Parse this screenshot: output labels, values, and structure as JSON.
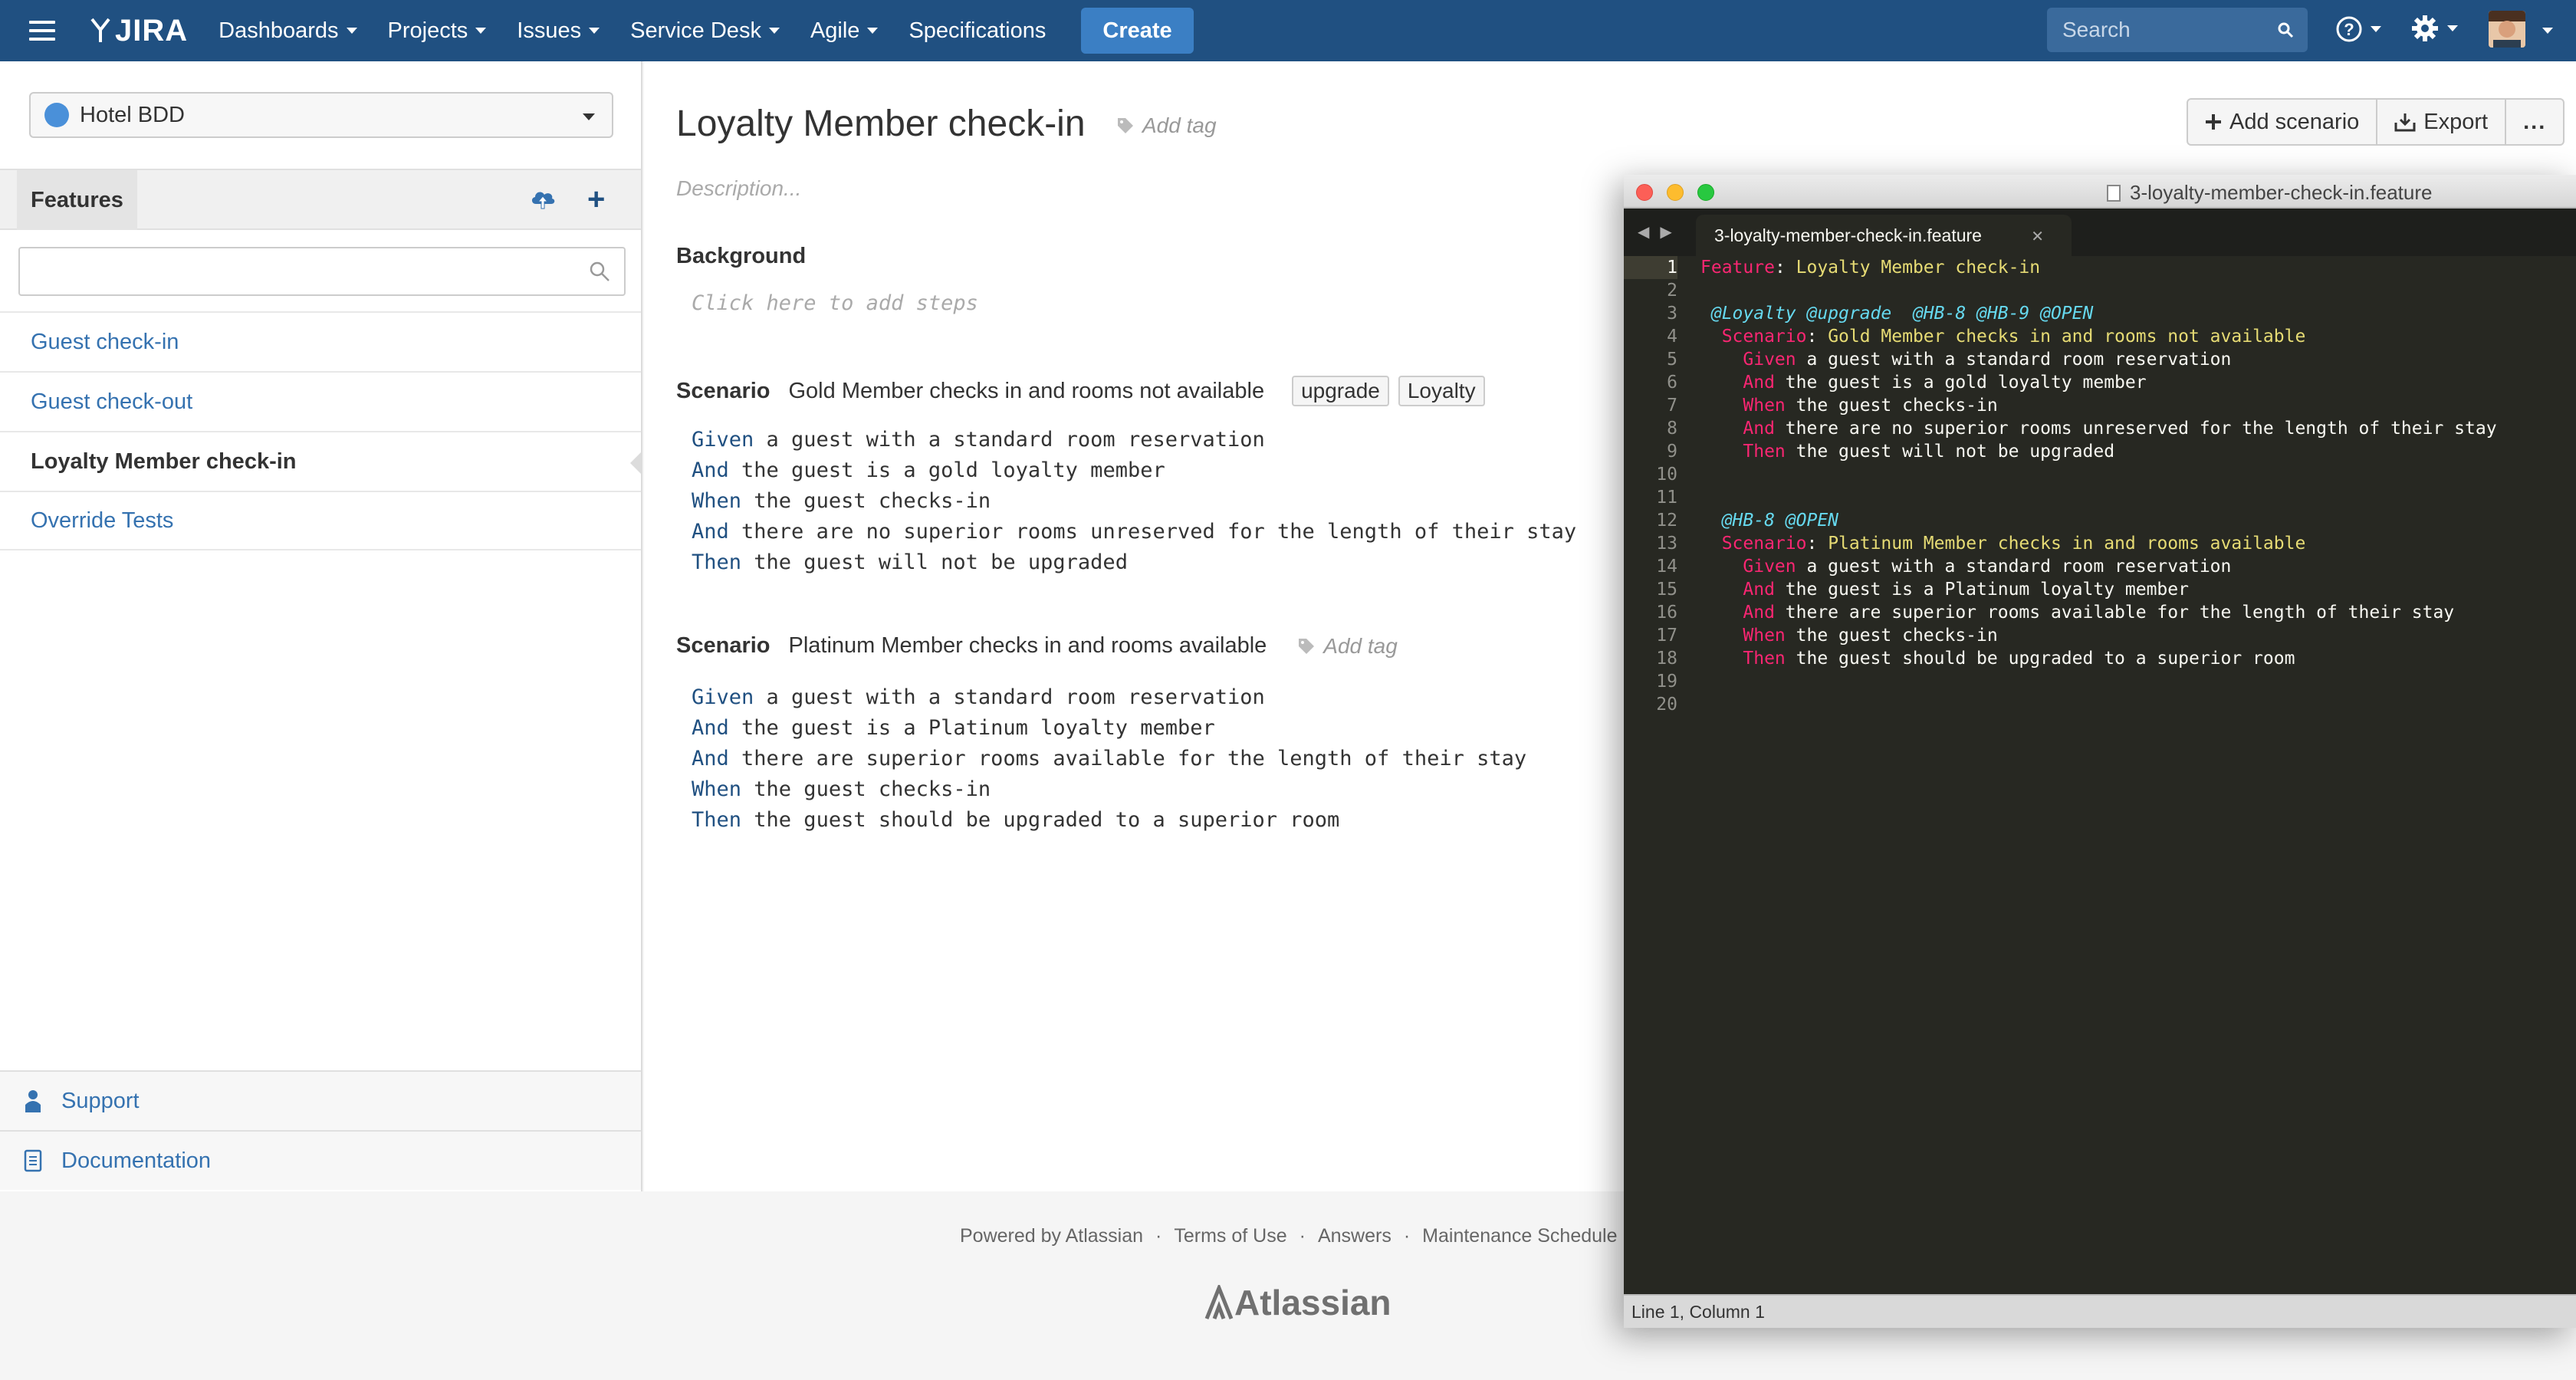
{
  "nav": {
    "logo": "JIRA",
    "items": [
      "Dashboards",
      "Projects",
      "Issues",
      "Service Desk",
      "Agile",
      "Specifications"
    ],
    "create": "Create",
    "search_placeholder": "Search"
  },
  "sidebar": {
    "project": "Hotel BDD",
    "features_tab": "Features",
    "features": [
      "Guest check-in",
      "Guest check-out",
      "Loyalty Member check-in",
      "Override Tests"
    ],
    "active_feature": 2,
    "support": "Support",
    "documentation": "Documentation"
  },
  "main": {
    "title": "Loyalty Member check-in",
    "add_tag": "Add tag",
    "description_placeholder": "Description...",
    "background_label": "Background",
    "background_hint": "Click here to add steps",
    "toolbar": {
      "add_scenario": "Add scenario",
      "export": "Export",
      "more": "..."
    },
    "scenario_label": "Scenario",
    "scenarios": [
      {
        "name": "Gold Member checks in and rooms not available",
        "tags": [
          "upgrade",
          "Loyalty"
        ],
        "steps": [
          {
            "kw": "Given",
            "text": " a guest with a standard room reservation"
          },
          {
            "kw": "And",
            "text": " the guest is a gold loyalty member"
          },
          {
            "kw": "When",
            "text": " the guest checks-in"
          },
          {
            "kw": "And",
            "text": " there are no superior rooms unreserved for the length of their stay"
          },
          {
            "kw": "Then",
            "text": " the guest will not be upgraded"
          }
        ]
      },
      {
        "name": "Platinum Member checks in and rooms available",
        "add_tag": "Add tag",
        "steps": [
          {
            "kw": "Given",
            "text": " a guest with a standard room reservation"
          },
          {
            "kw": "And",
            "text": " the guest is a Platinum loyalty member"
          },
          {
            "kw": "And",
            "text": " there are superior rooms available for the length of their stay"
          },
          {
            "kw": "When",
            "text": " the guest checks-in"
          },
          {
            "kw": "Then",
            "text": " the guest should be upgraded to a superior room"
          }
        ]
      }
    ]
  },
  "footer": {
    "links": [
      "Powered by Atlassian",
      "Terms of Use",
      "Answers",
      "Maintenance Schedule"
    ],
    "separator": "·",
    "logo": "Atlassian"
  },
  "editor": {
    "window_title": "3-loyalty-member-check-in.feature",
    "tab": "3-loyalty-member-check-in.feature",
    "status": "Line 1, Column 1",
    "lines": [
      [
        {
          "c": "kw",
          "t": "Feature"
        },
        {
          "c": "plain",
          "t": ": "
        },
        {
          "c": "str",
          "t": "Loyalty Member check-in"
        }
      ],
      [],
      [
        {
          "c": "tag",
          "t": " @Loyalty @upgrade  @HB-8 @HB-9 @OPEN"
        }
      ],
      [
        {
          "c": "kw",
          "t": "  Scenario"
        },
        {
          "c": "plain",
          "t": ": "
        },
        {
          "c": "str",
          "t": "Gold Member checks in and rooms not available"
        }
      ],
      [
        {
          "c": "kw",
          "t": "    Given"
        },
        {
          "c": "plain",
          "t": " a guest with a standard room reservation"
        }
      ],
      [
        {
          "c": "kw",
          "t": "    And"
        },
        {
          "c": "plain",
          "t": " the guest is a gold loyalty member"
        }
      ],
      [
        {
          "c": "kw",
          "t": "    When"
        },
        {
          "c": "plain",
          "t": " the guest checks-in"
        }
      ],
      [
        {
          "c": "kw",
          "t": "    And"
        },
        {
          "c": "plain",
          "t": " there are no superior rooms unreserved for the length of their stay"
        }
      ],
      [
        {
          "c": "kw",
          "t": "    Then"
        },
        {
          "c": "plain",
          "t": " the guest will not be upgraded"
        }
      ],
      [],
      [],
      [
        {
          "c": "tag",
          "t": "  @HB-8 @OPEN"
        }
      ],
      [
        {
          "c": "kw",
          "t": "  Scenario"
        },
        {
          "c": "plain",
          "t": ": "
        },
        {
          "c": "str",
          "t": "Platinum Member checks in and rooms available"
        }
      ],
      [
        {
          "c": "kw",
          "t": "    Given"
        },
        {
          "c": "plain",
          "t": " a guest with a standard room reservation"
        }
      ],
      [
        {
          "c": "kw",
          "t": "    And"
        },
        {
          "c": "plain",
          "t": " the guest is a Platinum loyalty member"
        }
      ],
      [
        {
          "c": "kw",
          "t": "    And"
        },
        {
          "c": "plain",
          "t": " there are superior rooms available for the length of their stay"
        }
      ],
      [
        {
          "c": "kw",
          "t": "    When"
        },
        {
          "c": "plain",
          "t": " the guest checks-in"
        }
      ],
      [
        {
          "c": "kw",
          "t": "    Then"
        },
        {
          "c": "plain",
          "t": " the guest should be upgraded to a superior room"
        }
      ],
      [],
      []
    ]
  },
  "colors": {
    "nav_bg": "#205081",
    "link": "#3572b0",
    "editor_bg": "#272822",
    "monokai_keyword": "#f92672",
    "monokai_string": "#e6db74",
    "monokai_tag": "#66d9ef"
  }
}
